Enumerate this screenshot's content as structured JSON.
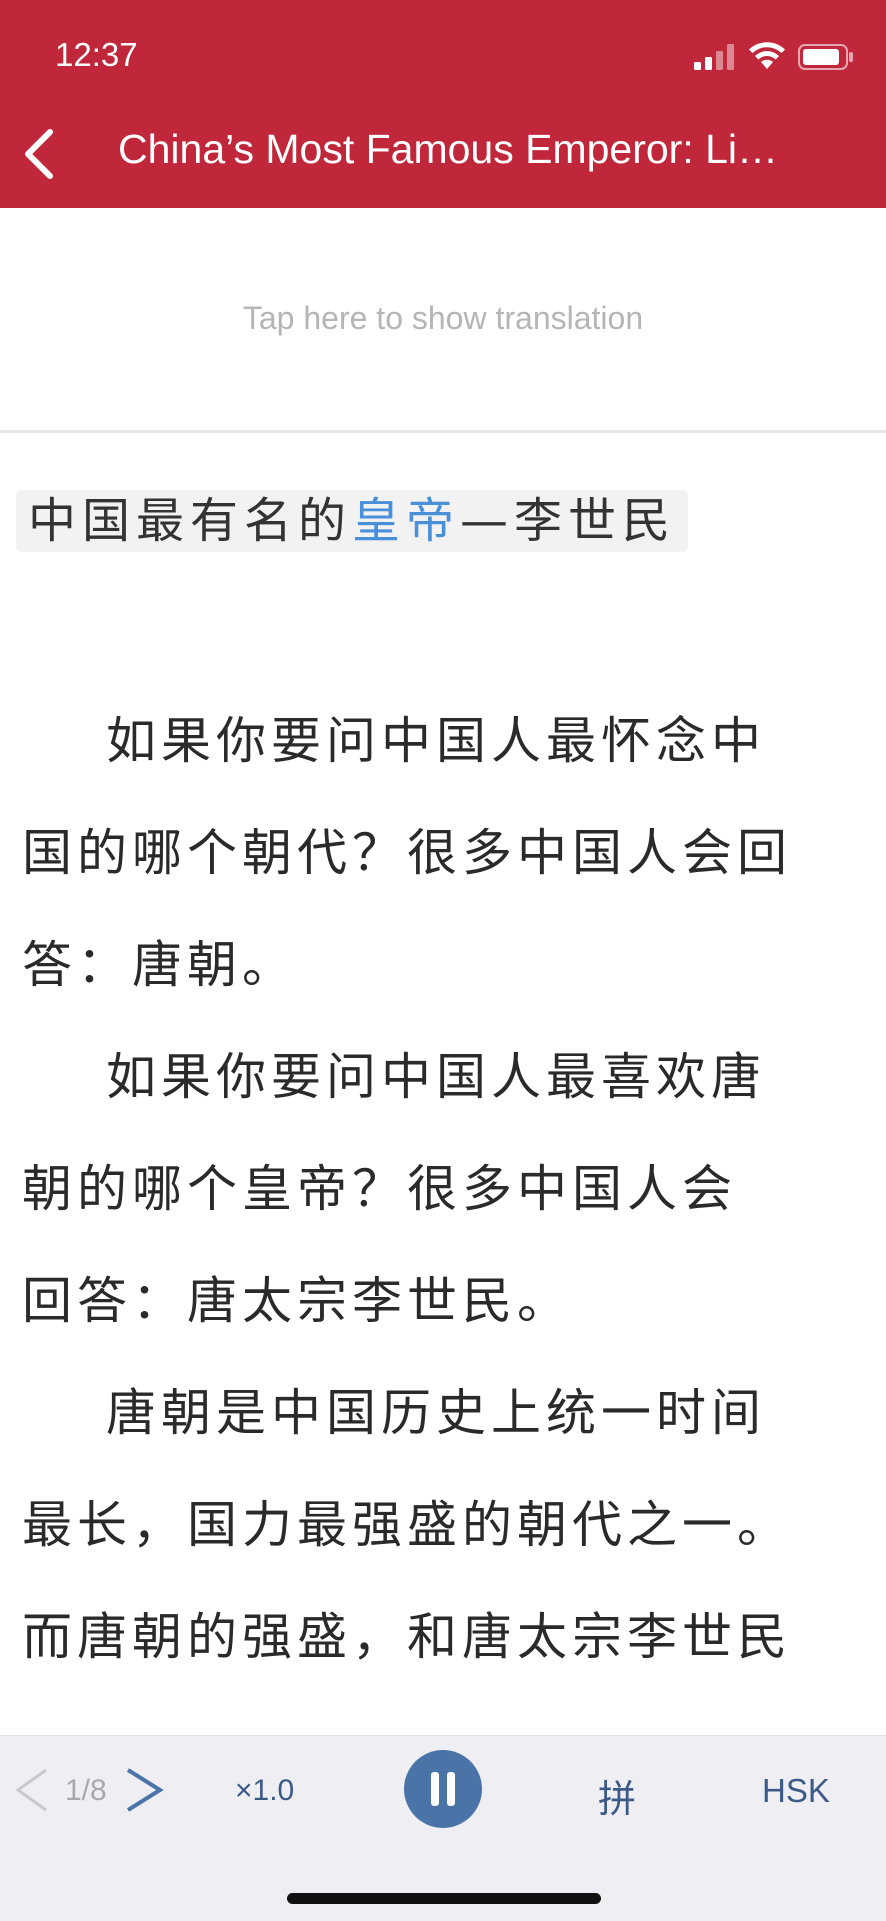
{
  "status_bar": {
    "time": "12:37"
  },
  "nav": {
    "title": "China’s Most Famous Emperor: Li…"
  },
  "translation": {
    "hint": "Tap here to show translation"
  },
  "article": {
    "heading": {
      "pre": "中国最有名的",
      "highlight": "皇帝",
      "post": "—李世民"
    },
    "lines": [
      "如果你要问中国人最怀念中",
      "国的哪个朝代？很多中国人会回",
      "答：唐朝。",
      "如果你要问中国人最喜欢唐",
      "朝的哪个皇帝？很多中国人会",
      "回答：唐太宗李世民。",
      "唐朝是中国历史上统一时间",
      "最长，国力最强盛的朝代之一。",
      "而唐朝的强盛，和唐太宗李世民"
    ]
  },
  "toolbar": {
    "page": "1/8",
    "speed": "×1.0",
    "pinyin": "拼",
    "hsk": "HSK"
  },
  "colors": {
    "header": "#c0273a",
    "highlight": "#4a90d9",
    "accent": "#4a74a8"
  }
}
